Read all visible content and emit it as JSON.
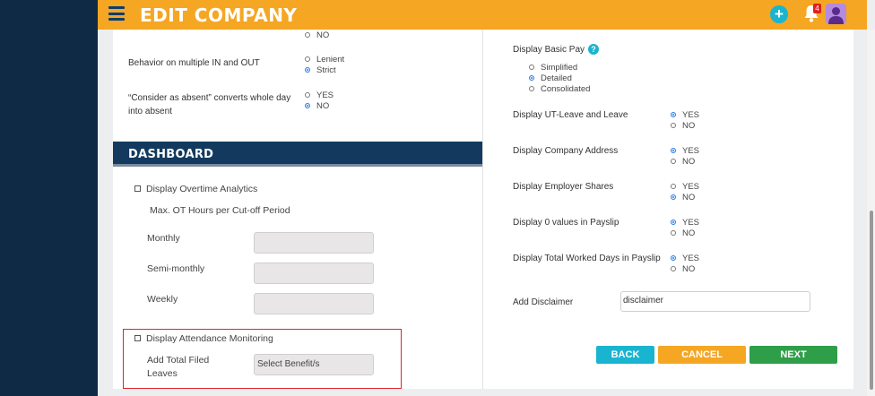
{
  "header": {
    "title": "EDIT COMPANY",
    "notification_count": "4",
    "add_symbol": "+"
  },
  "left": {
    "top_option_no": "NO",
    "multiple_in_out": {
      "label": "Behavior on multiple IN and OUT",
      "opt1": "Lenient",
      "opt2": "Strict"
    },
    "consider_absent": {
      "label": "“Consider as absent” converts whole day into absent",
      "opt1": "YES",
      "opt2": "NO"
    },
    "dashboard": {
      "title": "DASHBOARD",
      "overtime_label": "Display Overtime Analytics",
      "max_ot_label": "Max. OT Hours per Cut-off Period",
      "monthly": "Monthly",
      "semi_monthly": "Semi-monthly",
      "weekly": "Weekly",
      "attendance_label": "Display Attendance Monitoring",
      "filed_leaves_label": "Add Total Filed Leaves",
      "benefit_placeholder": "Select Benefit/s"
    }
  },
  "right": {
    "basic_pay": {
      "label": "Display Basic Pay",
      "help": "?",
      "opt1": "Simplified",
      "opt2": "Detailed",
      "opt3": "Consolidated"
    },
    "ut_leave": {
      "label": "Display UT-Leave and Leave",
      "opt1": "YES",
      "opt2": "NO"
    },
    "company_address": {
      "label": "Display Company Address",
      "opt1": "YES",
      "opt2": "NO"
    },
    "employer_shares": {
      "label": "Display Employer Shares",
      "opt1": "YES",
      "opt2": "NO"
    },
    "zero_values": {
      "label": "Display 0 values in Payslip",
      "opt1": "YES",
      "opt2": "NO"
    },
    "worked_days": {
      "label": "Display Total Worked Days in Payslip",
      "opt1": "YES",
      "opt2": "NO"
    },
    "disclaimer": {
      "label": "Add Disclaimer",
      "value": "disclaimer"
    }
  },
  "buttons": {
    "back": "BACK",
    "cancel": "CANCEL",
    "next": "NEXT"
  },
  "colors": {
    "topbar": "#f5a623",
    "sidebar": "#0f2a44",
    "dashboard_header": "#133a5e",
    "back": "#19b4d0",
    "cancel": "#f5a623",
    "next": "#2f9e49",
    "highlight": "#e0262c"
  }
}
